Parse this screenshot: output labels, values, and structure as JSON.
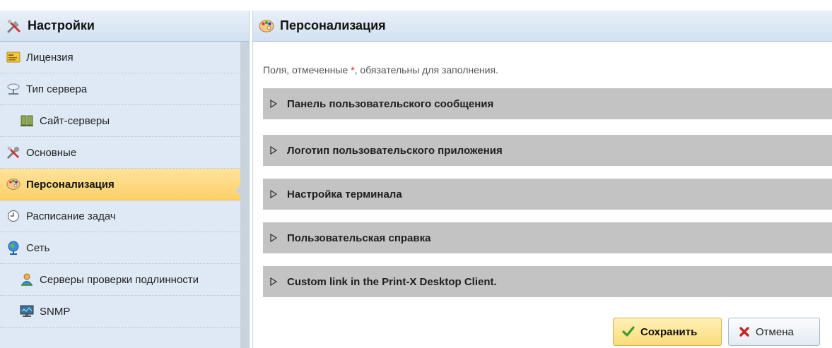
{
  "settings_panel": {
    "title": "Настройки",
    "icon": "tools-icon",
    "items": [
      {
        "label": "Лицензия",
        "icon": "license-icon"
      },
      {
        "label": "Тип сервера",
        "icon": "server-type-icon"
      },
      {
        "label": "Сайт-серверы",
        "icon": "site-servers-icon"
      },
      {
        "label": "Основные",
        "icon": "tools-icon"
      },
      {
        "label": "Персонализация",
        "icon": "palette-icon",
        "active": true
      },
      {
        "label": "Расписание задач",
        "icon": "clock-icon"
      },
      {
        "label": "Сеть",
        "icon": "network-icon"
      },
      {
        "label": "Серверы проверки подлинности",
        "icon": "user-icon"
      },
      {
        "label": "SNMP",
        "icon": "monitor-icon"
      }
    ]
  },
  "content": {
    "title": "Персонализация",
    "icon": "palette-icon",
    "hint_before": "Поля, отмеченные ",
    "hint_star": "*",
    "hint_after": ", обязательны для заполнения.",
    "sections": [
      "Панель пользовательского сообщения",
      "Логотип пользовательского приложения",
      "Настройка терминала",
      "Пользовательская справка",
      "Custom link in the Print-X Desktop Client."
    ],
    "save_label": "Сохранить",
    "cancel_label": "Отмена"
  },
  "colors": {
    "active_item": "#fcd06a",
    "section_bg": "#c3c3c3",
    "sidebar_bg": "#dfe9f5",
    "required_star": "#dd2222"
  }
}
